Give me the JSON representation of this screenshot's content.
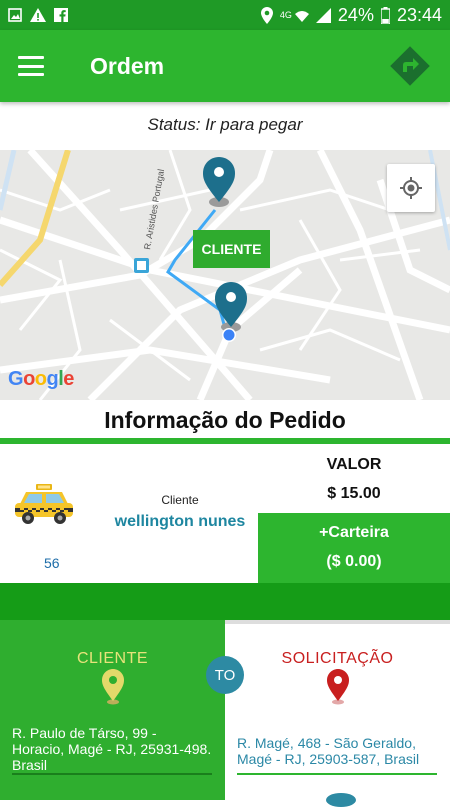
{
  "status_bar": {
    "network": "4G",
    "battery": "24%",
    "time": "23:44",
    "icons": [
      "image-icon",
      "warning-icon",
      "facebook-icon",
      "location-icon",
      "wifi-icon",
      "signal-icon",
      "battery-icon"
    ]
  },
  "app_bar": {
    "title": "Ordem",
    "menu_icon": "menu-icon",
    "nav_icon": "directions-icon"
  },
  "status_line": "Status: Ir para pegar",
  "map": {
    "street_label": "R. Aristides Portugal",
    "marker_label": "CLIENTE",
    "attribution": "Google",
    "locate_icon": "my-location-icon"
  },
  "order_info": {
    "title": "Informação do Pedido",
    "driver_id": "56",
    "client_caption": "Cliente",
    "client_name": "wellington nunes",
    "valor_label": "VALOR",
    "valor_value": "$ 15.00",
    "wallet_label": "+Carteira",
    "wallet_value": "($ 0.00)"
  },
  "route": {
    "client_title": "CLIENTE",
    "to_label": "TO",
    "request_title": "SOLICITAÇÃO",
    "client_address": "R. Paulo de Társo, 99 - Horacio, Magé - RJ, 25931-498. Brasil",
    "request_address": "R. Magé, 468 - São Geraldo, Magé - RJ, 25903-587, Brasil"
  },
  "colors": {
    "primary_green": "#2db52f",
    "dark_green": "#159c17",
    "link_blue": "#1e86a0",
    "request_red": "#c81f1f",
    "client_yellow": "#e7e37a"
  }
}
